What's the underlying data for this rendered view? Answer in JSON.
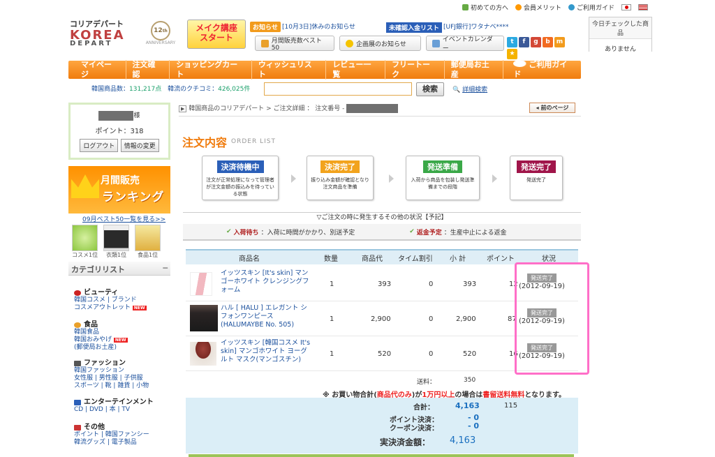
{
  "util_links": {
    "first": "初めての方へ",
    "member": "会員メリット",
    "guide": "ご利用ガイド"
  },
  "logo": {
    "top": "コリアデパート",
    "brand": "KOREA",
    "sub": "DEPART",
    "anniv": "12",
    "anniv_sub": "ANNIVERSARY"
  },
  "banner": {
    "line1": "メイク講座",
    "line2": "スタート"
  },
  "notice": {
    "tag": "お知らせ",
    "text": "[10月3日]休みのお知らせ"
  },
  "unconfirmed": {
    "tag": "未確認入金リスト",
    "text": "[UFJ銀行]ワタナベ****"
  },
  "header_buttons": [
    "月間販売数ベスト50",
    "企画展のお知らせ",
    "イベントカレンダー"
  ],
  "recent": {
    "title": "今日チェックした商品",
    "body": "ありません"
  },
  "nav": [
    "マイページ",
    "注文確認",
    "ショッピングカート",
    "ウィッシュリスト",
    "レビュー一覧",
    "フリートーク",
    "郵便局お土産",
    "ご利用ガイド"
  ],
  "stats": {
    "label1": "韓国商品数：",
    "count1": "131,217点",
    "label2": "韓流のクチコミ：",
    "count2": "426,025件"
  },
  "search": {
    "button": "検索",
    "advanced": "詳細検索",
    "placeholder": ""
  },
  "user": {
    "suffix": "様",
    "points": "ポイント：318",
    "logout": "ログアウト",
    "edit": "情報の変更"
  },
  "ranking": {
    "l1": "月間販売",
    "l2": "ランキング",
    "best": "09月ベスト50一覧を見る>>",
    "thumbs": [
      "コスメ1位",
      "衣類1位",
      "食品1位"
    ]
  },
  "categories": {
    "title": "カテゴリリスト",
    "groups": [
      {
        "head": "ビューティ",
        "l1": "韓国コスメ | ブランド",
        "l2": "コスメアウトレット"
      },
      {
        "head": "食品",
        "l1": "韓国食品",
        "l2": "韓国おみやげ",
        "l3": "(郵便局お土産)"
      },
      {
        "head": "ファッション",
        "l1": "韓国ファッション",
        "l2": "女性服 | 男性服 | 子供服",
        "l3": "スポーツ | 靴 | 雑貨 | 小物"
      },
      {
        "head": "エンターテインメント",
        "l1": "CD | DVD | 本 | TV"
      },
      {
        "head": "その他",
        "l1": "ポイント | 韓国ファンシー",
        "l2": "韓流グッズ | 電子製品"
      }
    ],
    "new_badge": "NEW"
  },
  "breadcrumb": "韓国商品のコリアデパート > ご注文詳細 ： 注文番号 -",
  "prev_page": "前のページ",
  "page_title": "注文内容",
  "page_subtitle": "ORDER LIST",
  "steps": [
    {
      "label": "決済待機中",
      "color": "#2b5fb8",
      "desc": "注文が正常処理になって管理者が注文金額の振込みを待っている状態"
    },
    {
      "label": "決済完了",
      "color": "#f2a31d",
      "desc": "振り込み金額が確認となり注文商品を準備"
    },
    {
      "label": "発送準備",
      "color": "#3aa848",
      "desc": "入荷から商品を包装し発送準備までの段階"
    },
    {
      "label": "発送完了",
      "color": "#a0154a",
      "desc": "発送完了"
    }
  ],
  "other_status": {
    "header": "▽ご注文の時に発生するその他の状況【予記】",
    "a_label": "入荷待ち",
    "a_text": "：入荷に時間がかかり、別送予定",
    "b_label": "返金予定",
    "b_text": "：生産中止による返金"
  },
  "table": {
    "headers": [
      "商品名",
      "数量",
      "商品代",
      "タイム割引",
      "小 計",
      "ポイント",
      "状況"
    ],
    "rows": [
      {
        "name": "イッツスキン [It's skin] マンゴーホワイト クレンジングフォーム",
        "qty": "1",
        "price": "393",
        "disc": "0",
        "sub": "393",
        "pt": "12",
        "status": "発送完了",
        "date": "(2012-09-19)"
      },
      {
        "name": "ハル [ HALU ] エレガント シフォンワンピース (HALUMAYBE No. 505)",
        "qty": "1",
        "price": "2,900",
        "disc": "0",
        "sub": "2,900",
        "pt": "87",
        "status": "発送完了",
        "date": "(2012-09-19)"
      },
      {
        "name": "イッツスキン [韓国コスメ It's skin] マンゴホワイト ヨーグルト マスク(マンゴスチン)",
        "qty": "1",
        "price": "520",
        "disc": "0",
        "sub": "520",
        "pt": "16",
        "status": "発送完了",
        "date": "(2012-09-19)"
      }
    ]
  },
  "shipping": {
    "label": "送料：",
    "value": "350"
  },
  "free_ship": {
    "a": "※ お買い物合計(",
    "b": "商品代のみ",
    "c": ")が",
    "d": "1万円以上",
    "e": "の場合は",
    "f": "書留送料無料",
    "g": "となります。"
  },
  "totals": {
    "sum_label": "合計：",
    "sum": "4,163",
    "points": "115",
    "pt_label": "ポイント決済：",
    "pt": "- 0",
    "cp_label": "クーポン決済：",
    "cp": "- 0",
    "final_label": "実決済金額：",
    "final": "4,163"
  }
}
